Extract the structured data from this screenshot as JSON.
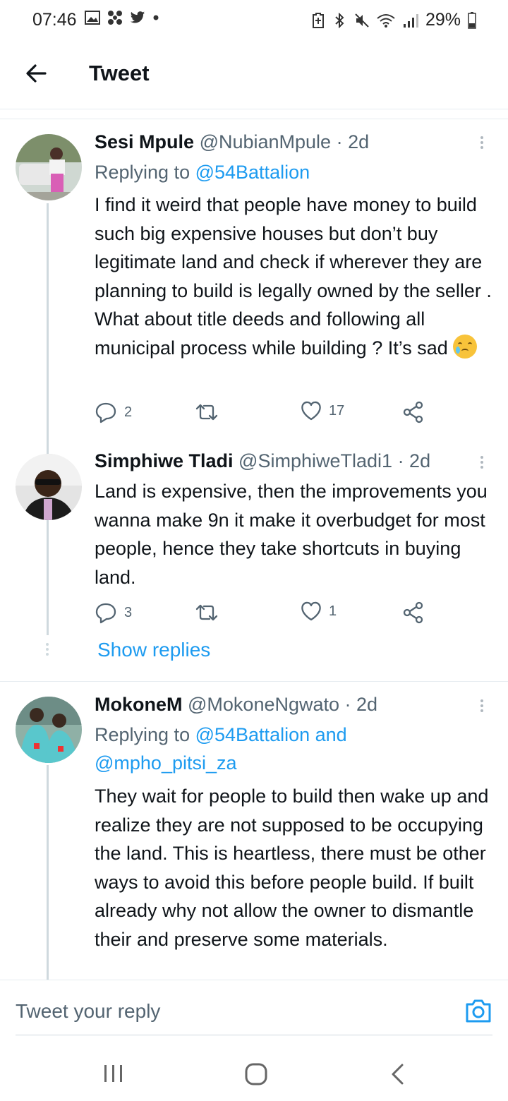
{
  "status_bar": {
    "time": "07:46",
    "battery": "29%",
    "left_icons": [
      "gallery-icon",
      "fan-icon",
      "twitter-icon",
      "dot-icon"
    ],
    "right_icons": [
      "battery-saver-icon",
      "bluetooth-icon",
      "mute-icon",
      "wifi-icon",
      "signal-icon",
      "battery-icon"
    ]
  },
  "header": {
    "title": "Tweet"
  },
  "tweets": [
    {
      "name": "Sesi Mpule",
      "handle": "@NubianMpule",
      "time": "· 2d",
      "reply_prefix": "Replying to ",
      "reply_to": "@54Battalion",
      "text": "I find it weird that people have money to build such big expensive houses but don’t buy legitimate land and check if wherever they are planning to build is legally owned by the seller . What about title deeds and following all municipal process while building ? It’s sad",
      "emoji": "crying-face",
      "replies": "2",
      "retweets": "",
      "likes": "17"
    },
    {
      "name": "Simphiwe Tladi",
      "handle": "@SimphiweTladi1",
      "time": "· 2d",
      "text": "Land is expensive, then the improvements you wanna make 9n it make it overbudget for most people, hence they take shortcuts in buying land.",
      "replies": "3",
      "retweets": "",
      "likes": "1"
    },
    {
      "name": "MokoneM",
      "handle": "@MokoneNgwato",
      "time": "· 2d",
      "reply_prefix": "Replying to ",
      "reply_to": "@54Battalion and",
      "reply_to_2": "@mpho_pitsi_za",
      "text": "They wait for people to build then wake up and realize they are not supposed to be occupying the land. This is heartless, there must be other ways to avoid this before people build. If built already why not allow the owner to dismantle their and preserve some materials."
    }
  ],
  "show_replies": "Show replies",
  "reply_bar": {
    "placeholder": "Tweet your reply"
  },
  "colors": {
    "link": "#1d9bf0",
    "text": "#0f1419",
    "muted": "#536471"
  }
}
